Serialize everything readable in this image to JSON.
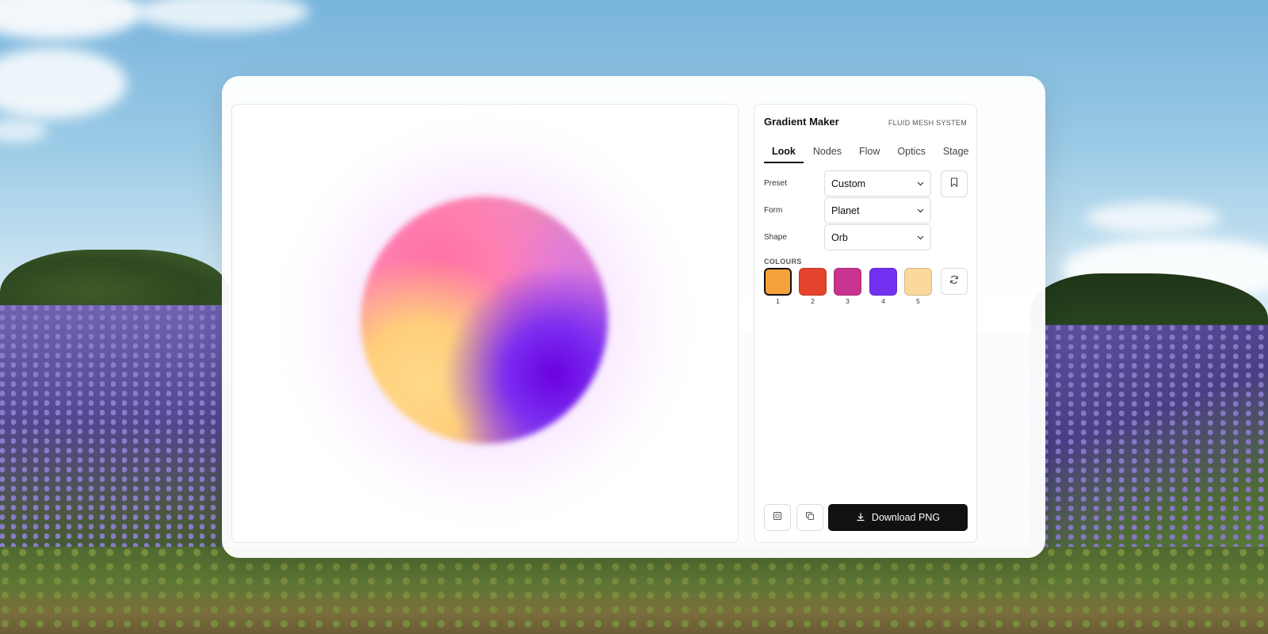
{
  "app": {
    "title": "Gradient Maker",
    "subtitle": "FLUID MESH SYSTEM"
  },
  "tabs": [
    {
      "label": "Look",
      "active": true
    },
    {
      "label": "Nodes",
      "active": false
    },
    {
      "label": "Flow",
      "active": false
    },
    {
      "label": "Optics",
      "active": false
    },
    {
      "label": "Stage",
      "active": false
    }
  ],
  "controls": {
    "preset": {
      "label": "Preset",
      "value": "Custom"
    },
    "form": {
      "label": "Form",
      "value": "Planet"
    },
    "shape": {
      "label": "Shape",
      "value": "Orb"
    }
  },
  "colours": {
    "label": "COLOURS",
    "swatches": [
      {
        "index": "1",
        "color": "#f5a23a",
        "selected": true
      },
      {
        "index": "2",
        "color": "#e5432b",
        "selected": false
      },
      {
        "index": "3",
        "color": "#c7338f",
        "selected": false
      },
      {
        "index": "4",
        "color": "#7231f0",
        "selected": false
      },
      {
        "index": "5",
        "color": "#fbd89c",
        "selected": false
      }
    ]
  },
  "actions": {
    "download_label": "Download PNG"
  },
  "icons": {
    "bookmark": "bookmark-icon",
    "refresh": "refresh-icon",
    "frame": "frame-icon",
    "copy": "copy-icon",
    "download": "download-icon",
    "chevron": "chevron-down-icon"
  }
}
